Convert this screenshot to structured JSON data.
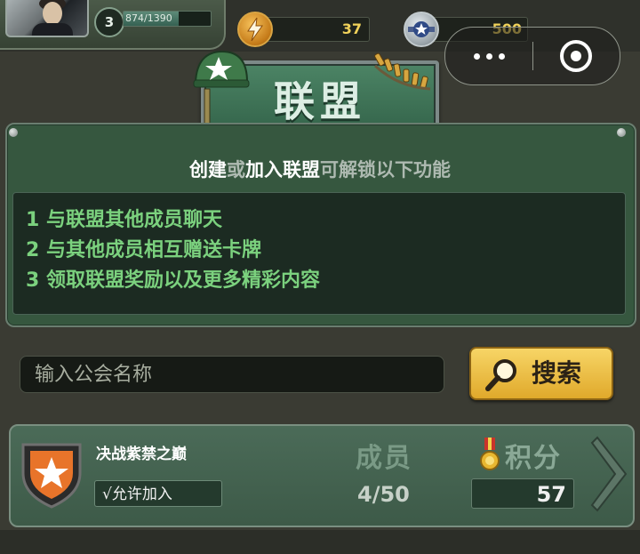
{
  "player": {
    "level": "3",
    "exp_text": "874/1390",
    "exp_progress": 0.63
  },
  "resources": {
    "energy": "37",
    "medals": "500"
  },
  "banner": {
    "title": "联盟"
  },
  "info": {
    "headline_parts": [
      "创建",
      "或",
      "加入联盟",
      "可解锁以下功能"
    ],
    "features": [
      "1 与联盟其他成员聊天",
      "2 与其他成员相互赠送卡牌",
      "3 领取联盟奖励以及更多精彩内容"
    ]
  },
  "search": {
    "placeholder": "输入公会名称",
    "button_label": "搜索"
  },
  "alliance": {
    "name": "决战紫禁之巅",
    "join_status": "√允许加入",
    "members_label": "成员",
    "members_value": "4/50",
    "score_label": "积分",
    "score_value": "57"
  },
  "colors": {
    "accent_gold": "#f1d25a",
    "feature_green": "#7bd17e",
    "panel_green": "#36573f",
    "button_yellow": "#f7d566"
  },
  "icons": {
    "energy": "lightning-icon",
    "medals": "star-badge-icon",
    "banner": "helmet-icon",
    "search": "magnifier-icon",
    "alliance": "shield-icon",
    "score": "medal-icon",
    "next": "chevron-right-icon"
  }
}
